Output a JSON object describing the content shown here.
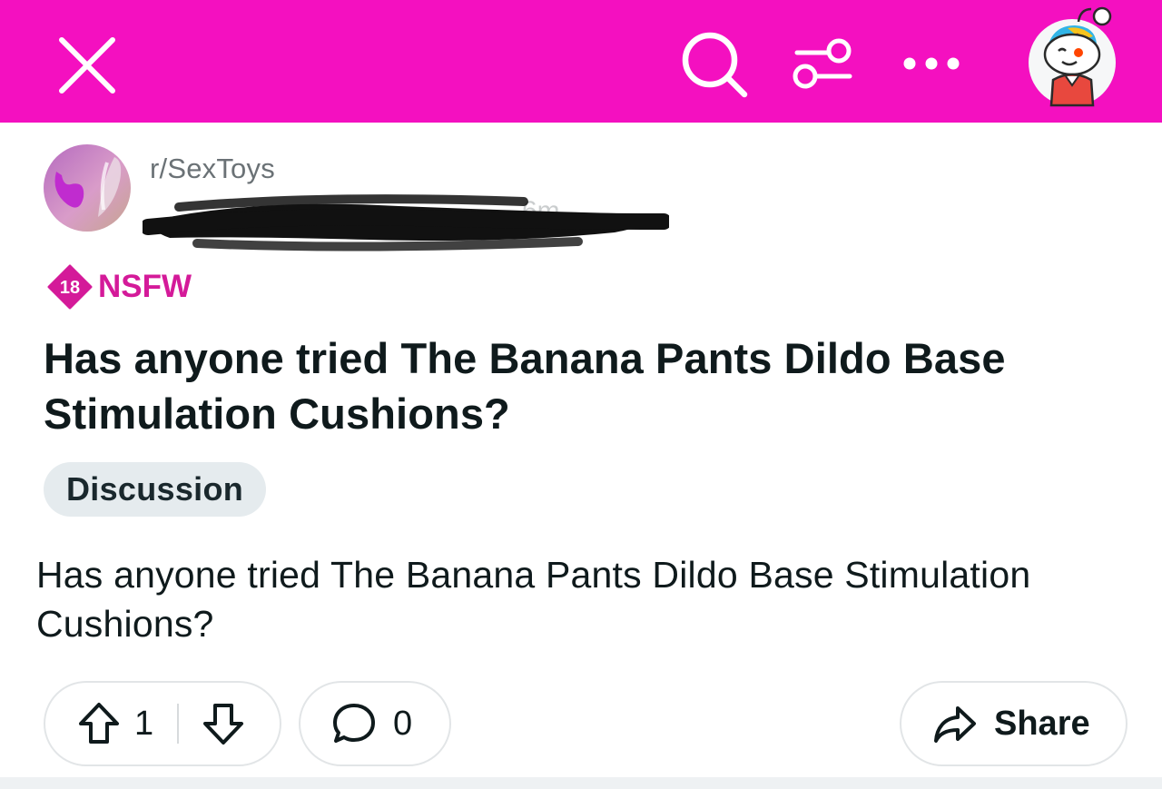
{
  "theme": {
    "header_bg": "#f410c0",
    "nsfw_color": "#d41a99",
    "flair_bg": "#e5ebee",
    "text_color": "#0f1a1c",
    "meta_color": "#6b7276"
  },
  "header": {
    "icons": [
      "close-icon",
      "search-icon",
      "filter-icon",
      "more-icon",
      "user-avatar"
    ]
  },
  "post": {
    "subreddit": "r/SexToys",
    "time_ago": "6m",
    "nsfw_badge": "18",
    "nsfw_label": "NSFW",
    "title": "Has anyone tried The Banana Pants Dildo Base Stimulation Cushions?",
    "flair": "Discussion",
    "body": "Has anyone tried The Banana Pants Dildo Base Stimulation Cushions?"
  },
  "actions": {
    "upvotes": "1",
    "comments": "0",
    "share_label": "Share",
    "icons": [
      "upvote-icon",
      "downvote-icon",
      "comment-icon",
      "share-icon"
    ]
  }
}
